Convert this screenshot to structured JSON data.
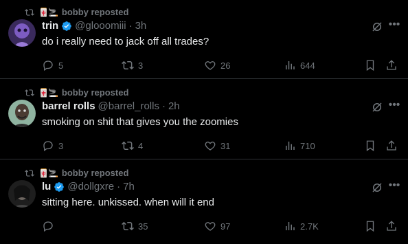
{
  "posts": [
    {
      "reposter": "bobby reposted",
      "reposter_glyphs": "🀄🚬",
      "name": "trin",
      "handle": "@glooomiii",
      "sep": "·",
      "time": "3h",
      "text": "do i really need to jack off all trades?",
      "reply_count": "5",
      "repost_count": "3",
      "like_count": "26",
      "view_count": "644",
      "avatar_color": "#5a3f8a"
    },
    {
      "reposter": "bobby reposted",
      "reposter_glyphs": "🀄🚬",
      "name": "barrel rolls",
      "handle": "@barrel_rolls",
      "sep": "·",
      "time": "2h",
      "text": "smoking on shit that gives you the zoomies",
      "reply_count": "3",
      "repost_count": "4",
      "like_count": "31",
      "view_count": "710",
      "avatar_color": "#6b8a7a"
    },
    {
      "reposter": "bobby reposted",
      "reposter_glyphs": "🀄🚬",
      "name": "lu",
      "handle": "@dollgxre",
      "sep": "·",
      "time": "7h",
      "text": "sitting here. unkissed. when will it end",
      "reply_count": "",
      "repost_count": "35",
      "like_count": "97",
      "view_count": "2.7K",
      "avatar_color": "#2a2a2a"
    }
  ],
  "more_glyph": "•••",
  "colors": {
    "muted": "#71767b",
    "verified": "#1d9bf0",
    "text": "#e7e9ea"
  }
}
